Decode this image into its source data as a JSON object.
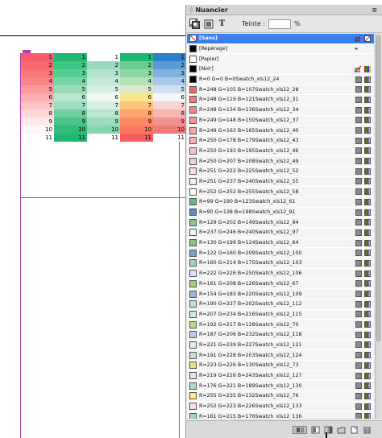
{
  "panel": {
    "title": "Nuancier",
    "tint_label": "Teinte :",
    "tint_value": "",
    "tint_unit": "%"
  },
  "grid": {
    "rows": [
      {
        "cells": [
          "1",
          "1",
          "1",
          "1",
          "1"
        ],
        "colors": [
          "#f85b69",
          "#1fb870",
          "#ffffff",
          "#1fb870",
          "#2f7fc8"
        ]
      },
      {
        "cells": [
          "2",
          "2",
          "2",
          "2",
          "2"
        ],
        "colors": [
          "#f8696e",
          "#3cc783",
          "#9bd9bd",
          "#68cc94",
          "#5a9bd6"
        ]
      },
      {
        "cells": [
          "3",
          "3",
          "3",
          "3",
          "3"
        ],
        "colors": [
          "#f8777b",
          "#56cf93",
          "#b2e2cb",
          "#8dd6a4",
          "#80b1de"
        ]
      },
      {
        "cells": [
          "4",
          "4",
          "4",
          "4",
          "4"
        ],
        "colors": [
          "#f98689",
          "#78d6a5",
          "#c4e9d7",
          "#b3e0b6",
          "#a8c9e7"
        ]
      },
      {
        "cells": [
          "5",
          "5",
          "5",
          "5",
          "5"
        ],
        "colors": [
          "#fa9a9c",
          "#99dcb6",
          "#d8f0e4",
          "#dde9c6",
          "#cfe0f0"
        ]
      },
      {
        "cells": [
          "6",
          "6",
          "6",
          "6",
          "6"
        ],
        "colors": [
          "#fbafb0",
          "#b8e6cc",
          "#eef8f3",
          "#fbe58a",
          "#f3f6fb"
        ]
      },
      {
        "cells": [
          "7",
          "7",
          "7",
          "7",
          "7"
        ],
        "colors": [
          "#fcc4c5",
          "#9fdcbf",
          "#d5efe2",
          "#fdc57c",
          "#f9d3d1"
        ]
      },
      {
        "cells": [
          "8",
          "8",
          "8",
          "8",
          "8"
        ],
        "colors": [
          "#fdd8d9",
          "#6fcf9f",
          "#b7e5ce",
          "#fca46e",
          "#f6b4b2"
        ]
      },
      {
        "cells": [
          "9",
          "9",
          "9",
          "9",
          "9"
        ],
        "colors": [
          "#feeaea",
          "#4dc487",
          "#9bdbbb",
          "#fb8a65",
          "#f2928f"
        ]
      },
      {
        "cells": [
          "10",
          "10",
          "10",
          "10",
          "10"
        ],
        "colors": [
          "#fff7f7",
          "#33bb79",
          "#86d3ad",
          "#f9795e",
          "#ef7b78"
        ]
      },
      {
        "cells": [
          "11",
          "11",
          "11",
          "11",
          "11"
        ],
        "colors": [
          "#ffffff",
          "#1fb870",
          "#ffffff",
          "#f75d5d",
          "#ffffff"
        ]
      }
    ]
  },
  "swatches": [
    {
      "name": "[Sans]",
      "color": "none",
      "selected": true,
      "type": "none"
    },
    {
      "name": "[Repérage]",
      "color": "#000000",
      "type": "reg"
    },
    {
      "name": "[Papier]",
      "color": "#ffffff",
      "type": "plain"
    },
    {
      "name": "[Noir]",
      "color": "#000000",
      "type": "lock"
    },
    {
      "name": "R=0 G=0 B=0Swatch_xls12_24",
      "color": "#000000",
      "type": "std"
    },
    {
      "name": "R=248 G=105 B=107Swatch_xls12_28",
      "color": "#f8696b",
      "type": "std"
    },
    {
      "name": "R=248 G=119 B=121Swatch_xls12_31",
      "color": "#f87779",
      "type": "std"
    },
    {
      "name": "R=248 G=134 B=136Swatch_xls12_34",
      "color": "#f88688",
      "type": "std"
    },
    {
      "name": "R=249 G=148 B=150Swatch_xls12_37",
      "color": "#f99496",
      "type": "std"
    },
    {
      "name": "R=249 G=163 B=165Swatch_xls12_40",
      "color": "#f9a3a5",
      "type": "std"
    },
    {
      "name": "R=250 G=178 B=179Swatch_xls12_43",
      "color": "#fab2b3",
      "type": "std"
    },
    {
      "name": "R=250 G=193 B=195Swatch_xls12_46",
      "color": "#fac1c3",
      "type": "std"
    },
    {
      "name": "R=250 G=207 B=208Swatch_xls12_49",
      "color": "#facfd0",
      "type": "std"
    },
    {
      "name": "R=251 G=222 B=225Swatch_xls12_52",
      "color": "#fbdee1",
      "type": "std"
    },
    {
      "name": "R=251 G=237 B=240Swatch_xls12_55",
      "color": "#fbedf0",
      "type": "std"
    },
    {
      "name": "R=252 G=252 B=255Swatch_xls12_58",
      "color": "#fcfcff",
      "type": "std"
    },
    {
      "name": "R=99 G=190 B=123Swatch_xls12_61",
      "color": "#63be7b",
      "type": "std"
    },
    {
      "name": "R=90 G=138 B=198Swatch_xls12_91",
      "color": "#5a8ac6",
      "type": "std"
    },
    {
      "name": "R=129 G=202 B=149Swatch_xls12_94",
      "color": "#81ca95",
      "type": "std"
    },
    {
      "name": "R=237 G=246 B=240Swatch_xls12_97",
      "color": "#edf6f0",
      "type": "std"
    },
    {
      "name": "R=130 G=199 B=124Swatch_xls12_64",
      "color": "#82c77c",
      "type": "std"
    },
    {
      "name": "R=122 G=160 B=209Swatch_xls12_100",
      "color": "#7aa0d1",
      "type": "std"
    },
    {
      "name": "R=160 G=214 B=175Swatch_xls12_103",
      "color": "#a0d6af",
      "type": "std"
    },
    {
      "name": "R=222 G=226 B=250Swatch_xls12_106",
      "color": "#dee2fa",
      "type": "std"
    },
    {
      "name": "R=161 G=208 B=126Swatch_xls12_67",
      "color": "#a1d07e",
      "type": "std"
    },
    {
      "name": "R=154 G=183 B=220Swatch_xls12_109",
      "color": "#9ab7dc",
      "type": "std"
    },
    {
      "name": "R=190 G=227 B=202Swatch_xls12_112",
      "color": "#bee3ca",
      "type": "std"
    },
    {
      "name": "R=207 G=234 B=216Swatch_xls12_115",
      "color": "#cfead8",
      "type": "std"
    },
    {
      "name": "R=192 G=217 B=128Swatch_xls12_70",
      "color": "#c0d980",
      "type": "std"
    },
    {
      "name": "R=187 G=206 B=232Swatch_xls12_118",
      "color": "#bbcee8",
      "type": "std"
    },
    {
      "name": "R=221 G=239 B=227Swatch_xls12_121",
      "color": "#ddefe3",
      "type": "std"
    },
    {
      "name": "R=191 G=228 B=203Swatch_xls12_124",
      "color": "#bfe4cb",
      "type": "std"
    },
    {
      "name": "R=223 G=226 B=130Swatch_xls12_73",
      "color": "#dfe282",
      "type": "std"
    },
    {
      "name": "R=219 G=226 B=243Swatch_xls12_127",
      "color": "#dbe2f3",
      "type": "std"
    },
    {
      "name": "R=176 G=221 B=189Swatch_xls12_130",
      "color": "#b0ddbd",
      "type": "std"
    },
    {
      "name": "R=255 G=235 B=132Swatch_xls12_76",
      "color": "#ffeb84",
      "type": "std"
    },
    {
      "name": "R=252 G=223 B=226Swatch_xls12_133",
      "color": "#fcdfe2",
      "type": "std"
    },
    {
      "name": "R=161 G=215 B=176Swatch_xls12_136",
      "color": "#a1d7b0",
      "type": "std"
    }
  ]
}
